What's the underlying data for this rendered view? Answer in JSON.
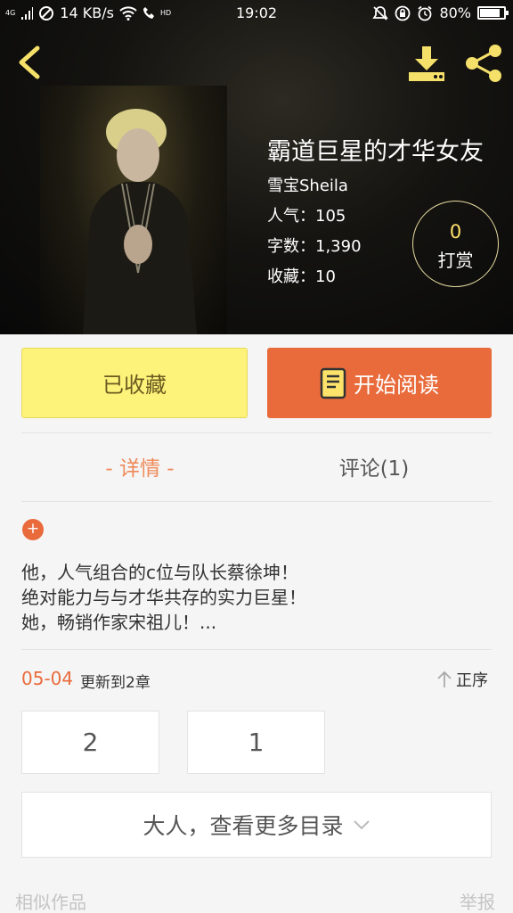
{
  "status_bar": {
    "network_tag": "4G",
    "speed": "14 KB/s",
    "time": "19:02",
    "hd_tag": "HD",
    "battery": "80%",
    "battery_level": 0.8
  },
  "header": {
    "back_icon": "chevron-left-icon",
    "download_icon": "download-icon",
    "share_icon": "share-icon"
  },
  "book": {
    "title": "霸道巨星的才华女友",
    "author": "雪宝Sheila",
    "popularity": "人气：105",
    "word_count": "字数：1,390",
    "favorites": "收藏：10"
  },
  "reward": {
    "count": "0",
    "label": "打赏"
  },
  "actions": {
    "favorite_label": "已收藏",
    "read_label": "开始阅读"
  },
  "tabs": {
    "detail": "- 详情 -",
    "comments": "评论(1)"
  },
  "description": {
    "expand": "+",
    "lines": [
      "他，人气组合的c位与队长蔡徐坤！",
      "绝对能力与与才华共存的实力巨星！",
      "她，畅销作家宋祖儿！..."
    ]
  },
  "update": {
    "date": "05-04",
    "text": "更新到2章",
    "sort_label": "正序"
  },
  "chapters": [
    "2",
    "1"
  ],
  "more_catalog": "大人，查看更多目录",
  "footer": {
    "similar": "相似作品",
    "report": "举报"
  },
  "colors": {
    "accent": "#e96b3c",
    "favorite_bg": "#fdf27a",
    "tab_active": "#ef8a5a",
    "icon_yellow": "#f5e16a"
  }
}
